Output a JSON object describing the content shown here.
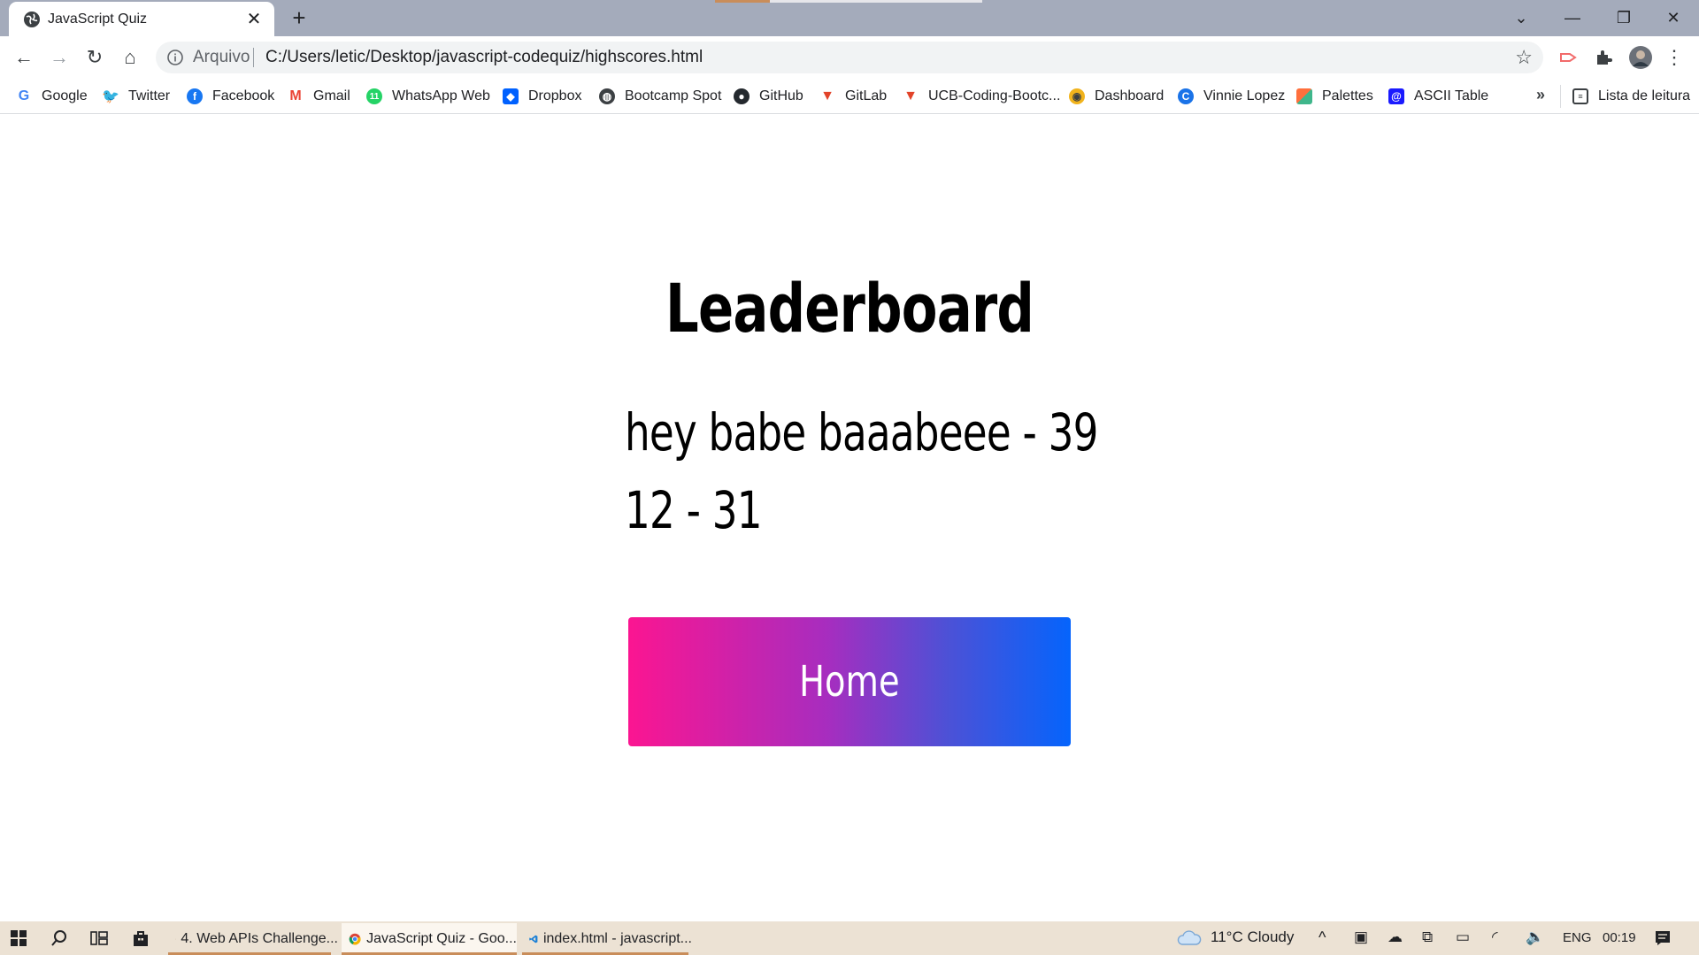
{
  "browser": {
    "tab_title": "JavaScript Quiz",
    "address_scheme": "Arquivo",
    "address_url": "C:/Users/letic/Desktop/javascript-codequiz/highscores.html",
    "reading_list_label": "Lista de leitura",
    "bookmarks": [
      {
        "label": "Google",
        "icon": "google-icon",
        "color": "#4285f4"
      },
      {
        "label": "Twitter",
        "icon": "twitter-icon",
        "color": "#1da1f2"
      },
      {
        "label": "Facebook",
        "icon": "facebook-icon",
        "color": "#1877f2"
      },
      {
        "label": "Gmail",
        "icon": "gmail-icon",
        "color": "#ea4335"
      },
      {
        "label": "WhatsApp Web",
        "icon": "whatsapp-icon",
        "color": "#25d366"
      },
      {
        "label": "Dropbox",
        "icon": "dropbox-icon",
        "color": "#0061ff"
      },
      {
        "label": "Bootcamp Spot",
        "icon": "globe-icon",
        "color": "#3c4043"
      },
      {
        "label": "GitHub",
        "icon": "github-icon",
        "color": "#24292e"
      },
      {
        "label": "GitLab",
        "icon": "gitlab-icon",
        "color": "#e24329"
      },
      {
        "label": "UCB-Coding-Bootc...",
        "icon": "gitlab-icon",
        "color": "#e24329"
      },
      {
        "label": "Dashboard",
        "icon": "dashboard-icon",
        "color": "#f1b31c"
      },
      {
        "label": "Vinnie Lopez",
        "icon": "vinnie-icon",
        "color": "#1a73e8"
      },
      {
        "label": "Palettes",
        "icon": "palettes-icon",
        "color": "#ff6f3c"
      },
      {
        "label": "ASCII Table",
        "icon": "ascii-icon",
        "color": "#1a1aff"
      }
    ]
  },
  "page": {
    "title": "Leaderboard",
    "scores": [
      "hey babe baaabeee - 39",
      "12 - 31"
    ],
    "home_button_label": "Home",
    "button_gradient": [
      "#fb1591",
      "#0564fc"
    ]
  },
  "taskbar": {
    "items": [
      {
        "label": "4. Web APIs Challenge...",
        "icon": "chrome-icon"
      },
      {
        "label": "JavaScript Quiz - Goo...",
        "icon": "chrome-icon"
      },
      {
        "label": "index.html - javascript...",
        "icon": "vscode-icon"
      }
    ],
    "weather": "11°C  Cloudy",
    "language": "ENG",
    "time": "00:19"
  }
}
